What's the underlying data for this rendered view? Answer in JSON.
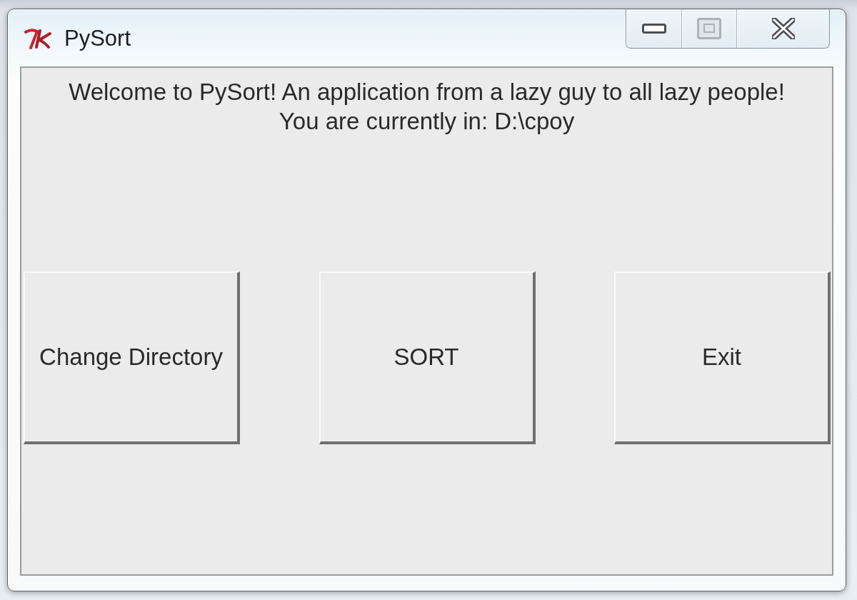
{
  "window": {
    "title": "PySort",
    "controls": [
      {
        "kind": "minimize",
        "disabled": false
      },
      {
        "kind": "maximize",
        "disabled": true
      },
      {
        "kind": "close",
        "disabled": false
      }
    ]
  },
  "message": {
    "lines": [
      "Welcome to PySort! An application from a lazy guy to all lazy people!",
      "You are currently in: D:\\cpoy"
    ]
  },
  "buttons": [
    {
      "label": "Change Directory"
    },
    {
      "label": "SORT"
    },
    {
      "label": "Exit"
    }
  ]
}
